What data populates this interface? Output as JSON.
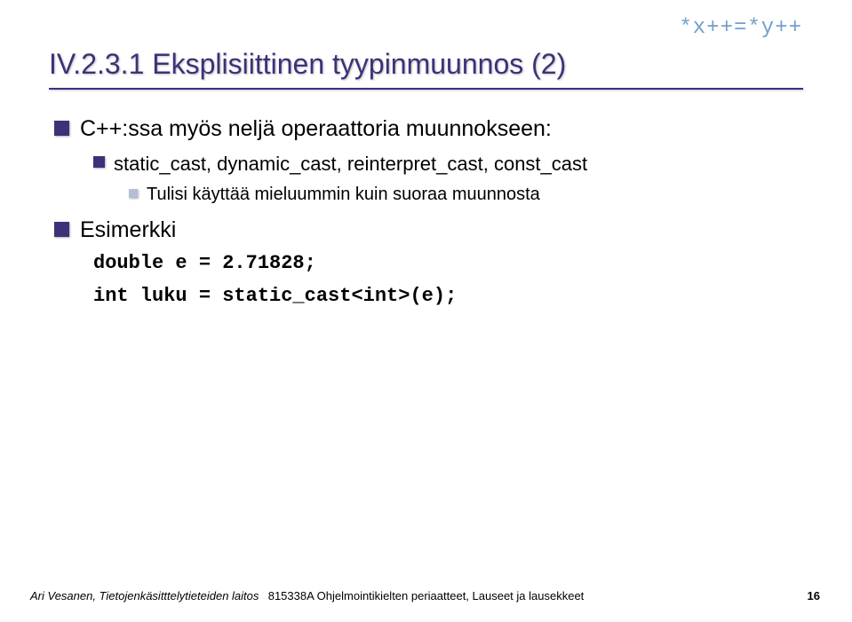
{
  "annotation": "*x++=*y++",
  "title": "IV.2.3.1 Eksplisiittinen tyypinmuunnos (2)",
  "body": {
    "l1a": "C++:ssa myös neljä operaattoria muunnokseen:",
    "l2a": "static_cast, dynamic_cast, reinterpret_cast, const_cast",
    "l3a": "Tulisi käyttää mieluummin kuin suoraa muunnosta",
    "l1b": "Esimerkki",
    "code1": "double e = 2.71828;",
    "code2": "int luku = static_cast<int>(e);"
  },
  "footer": {
    "left": "Ari Vesanen, Tietojenkäsitttelytieteiden laitos",
    "center": "815338A Ohjelmointikielten periaatteet, Lauseet ja lausekkeet",
    "right": "16"
  }
}
